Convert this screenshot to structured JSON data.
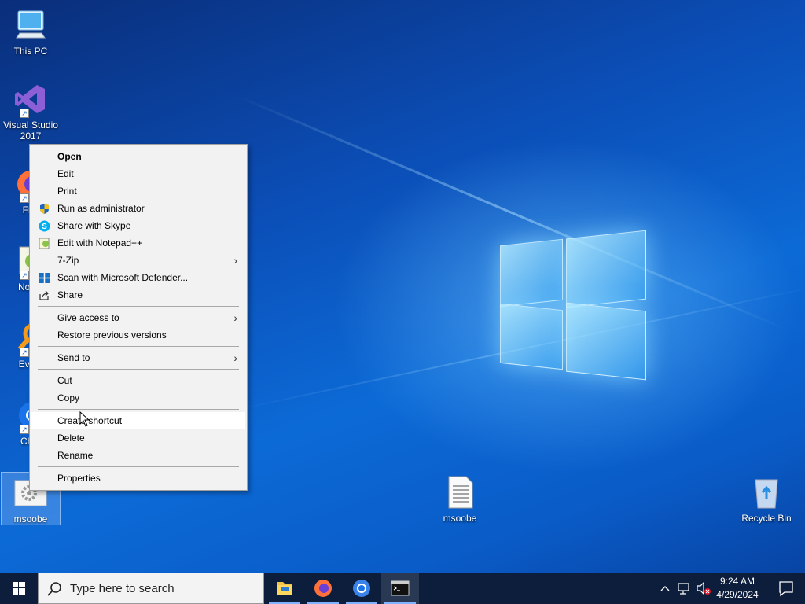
{
  "desktop": {
    "icons": [
      {
        "label": "This PC",
        "icon": "monitor-icon"
      },
      {
        "label": "Visual Studio\n2017",
        "icon": "visual-studio-icon"
      },
      {
        "label": "Firefox",
        "icon": "firefox-icon",
        "visible_label": "Fire"
      },
      {
        "label": "Notepad++",
        "icon": "notepadpp-icon",
        "visible_label": "Notep"
      },
      {
        "label": "Everything",
        "icon": "everything-icon",
        "visible_label": "Every"
      },
      {
        "label": "Chrome",
        "icon": "chrome-icon",
        "visible_label": "Chro"
      },
      {
        "label": "msoobe",
        "icon": "settings-file-icon"
      },
      {
        "label": "msoobe",
        "icon": "text-file-icon"
      },
      {
        "label": "Recycle Bin",
        "icon": "recycle-bin-icon"
      }
    ]
  },
  "context_menu": {
    "items": [
      {
        "label": "Open",
        "bold": true
      },
      {
        "label": "Edit"
      },
      {
        "label": "Print"
      },
      {
        "label": "Run as administrator",
        "icon": "uac-shield-icon"
      },
      {
        "label": "Share with Skype",
        "icon": "skype-icon"
      },
      {
        "label": "Edit with Notepad++",
        "icon": "notepadpp-icon"
      },
      {
        "label": "7-Zip",
        "submenu": true
      },
      {
        "label": "Scan with Microsoft Defender...",
        "icon": "defender-icon"
      },
      {
        "label": "Share",
        "icon": "share-icon"
      },
      {
        "label": "Give access to",
        "submenu": true
      },
      {
        "label": "Restore previous versions"
      },
      {
        "label": "Send to",
        "submenu": true
      },
      {
        "label": "Cut"
      },
      {
        "label": "Copy"
      },
      {
        "label": "Create shortcut",
        "highlighted": true
      },
      {
        "label": "Delete"
      },
      {
        "label": "Rename"
      },
      {
        "label": "Properties"
      }
    ],
    "submenu_arrow": "›"
  },
  "taskbar": {
    "search_placeholder": "Type here to search",
    "apps": [
      "file-explorer-icon",
      "firefox-icon",
      "chrome-icon",
      "terminal-icon"
    ],
    "clock_time": "9:24 AM",
    "clock_date": "4/29/2024"
  },
  "colors": {
    "accent": "#0078d7",
    "taskbar": "#0c1e3c",
    "menu_bg": "#f2f2f2"
  }
}
